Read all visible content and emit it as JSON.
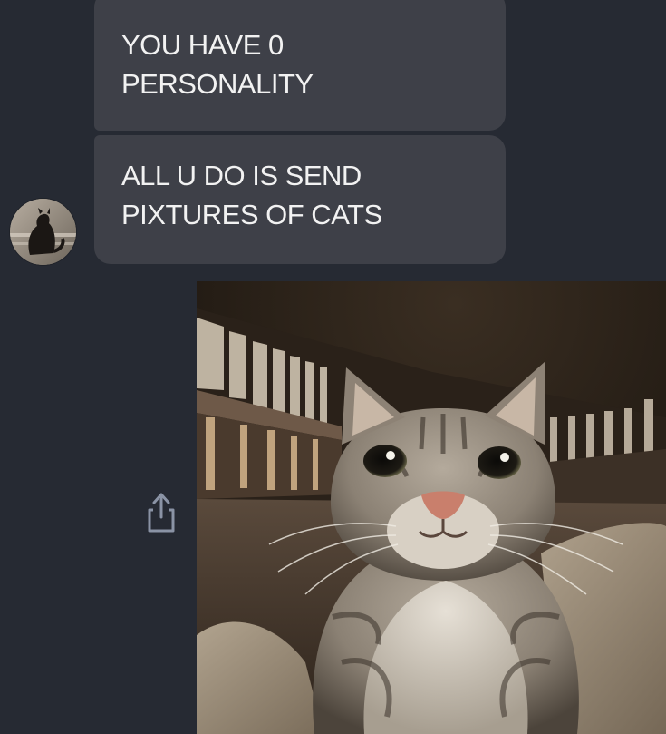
{
  "conversation": {
    "messages": [
      {
        "lines": [
          "YOU HAVE 0",
          "PERSONALITY"
        ]
      },
      {
        "lines": [
          "ALL U DO IS SEND",
          "PIXTURES OF CATS"
        ]
      }
    ],
    "sender_avatar": "contact-avatar",
    "attachment": {
      "kind": "photo",
      "subject": "tabby cat"
    },
    "actions": {
      "share_icon": "share-icon"
    }
  },
  "colors": {
    "background": "#262a33",
    "bubble": "#3e4048",
    "text": "#f2f2f2",
    "icon": "#8a93a5"
  }
}
